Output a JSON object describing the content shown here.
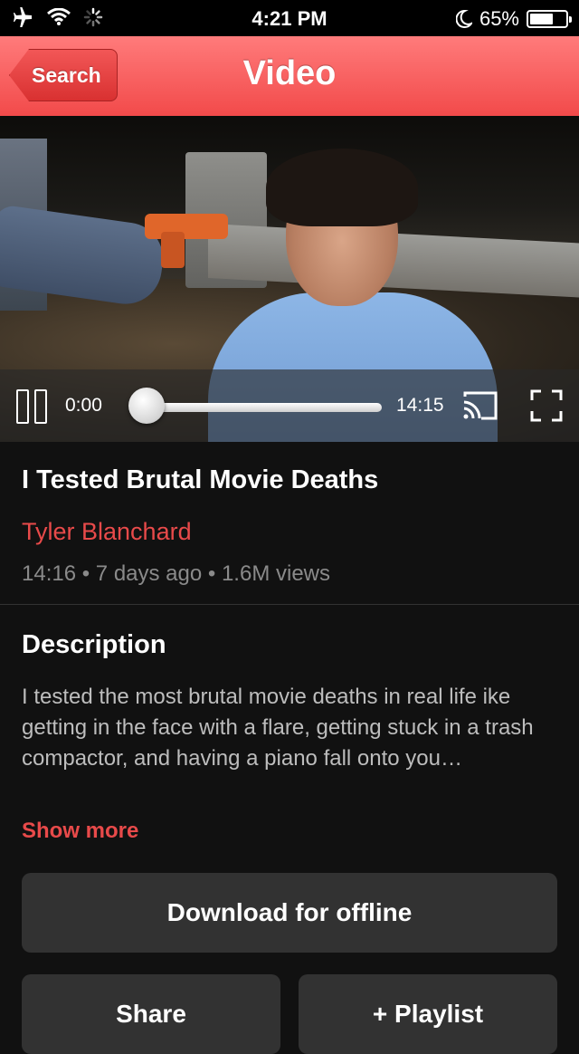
{
  "status_bar": {
    "time": "4:21 PM",
    "battery_percent": "65%",
    "battery_level": 0.65,
    "icons": [
      "airplane-icon",
      "wifi-icon",
      "activity-spinner-icon",
      "moon-icon",
      "battery-icon"
    ]
  },
  "nav": {
    "back_label": "Search",
    "title": "Video"
  },
  "player": {
    "current_time": "0:00",
    "duration": "14:15",
    "progress": 0.0,
    "icons": [
      "pause-icon",
      "cast-icon",
      "fullscreen-icon"
    ]
  },
  "video": {
    "title": "I Tested Brutal Movie Deaths",
    "channel": "Tyler Blanchard",
    "meta": "14:16 • 7 days ago • 1.6M views"
  },
  "description": {
    "heading": "Description",
    "text": "I tested the most brutal movie deaths in real life ike getting in the face with a flare, getting stuck in a trash compactor, and having a piano fall onto you…",
    "show_more": "Show more"
  },
  "actions": {
    "download": "Download for offline",
    "share": "Share",
    "playlist": "+ Playlist"
  },
  "colors": {
    "accent": "#e84a4a",
    "nav_top": "#ff7b7b",
    "nav_bottom": "#f24a4a",
    "background": "#111111",
    "button": "#323232"
  }
}
